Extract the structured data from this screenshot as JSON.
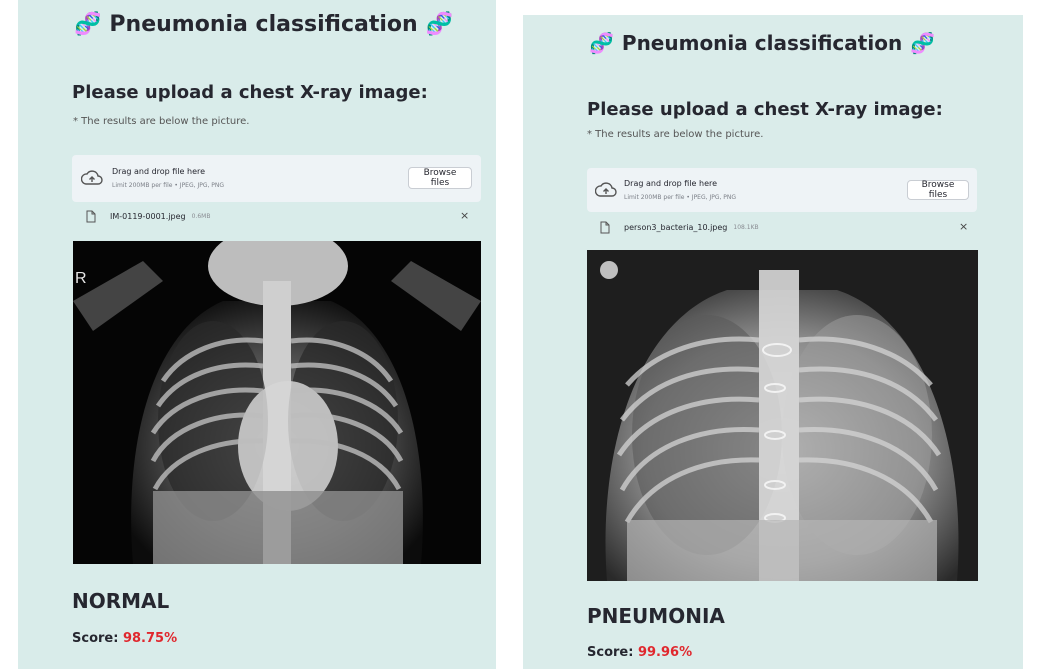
{
  "panels": [
    {
      "title": "Pneumonia classification",
      "upload_heading": "Please upload a chest X-ray image:",
      "note": "* The results are below the picture.",
      "dropzone": {
        "main_text": "Drag and drop file here",
        "limit_text": "Limit 200MB per file • JPEG, JPG, PNG",
        "browse_label": "Browse files"
      },
      "file": {
        "name": "IM-0119-0001.jpeg",
        "size": "0.6MB",
        "close": "×"
      },
      "xray_marker": "R",
      "result": "NORMAL",
      "score_label": "Score:",
      "score_value": "98.75%"
    },
    {
      "title": "Pneumonia classification",
      "upload_heading": "Please upload a chest X-ray image:",
      "note": "* The results are below the picture.",
      "dropzone": {
        "main_text": "Drag and drop file here",
        "limit_text": "Limit 200MB per file • JPEG, JPG, PNG",
        "browse_label": "Browse files"
      },
      "file": {
        "name": "person3_bacteria_10.jpeg",
        "size": "108.1KB",
        "close": "×"
      },
      "result": "PNEUMONIA",
      "score_label": "Score:",
      "score_value": "99.96%"
    }
  ],
  "colors": {
    "panel_bg": "#d9ecea",
    "score_red": "#e0282e",
    "dropzone_bg": "#eef3f6"
  },
  "icons": [
    "dna-icon",
    "cloud-upload-icon",
    "file-icon",
    "close-icon"
  ]
}
